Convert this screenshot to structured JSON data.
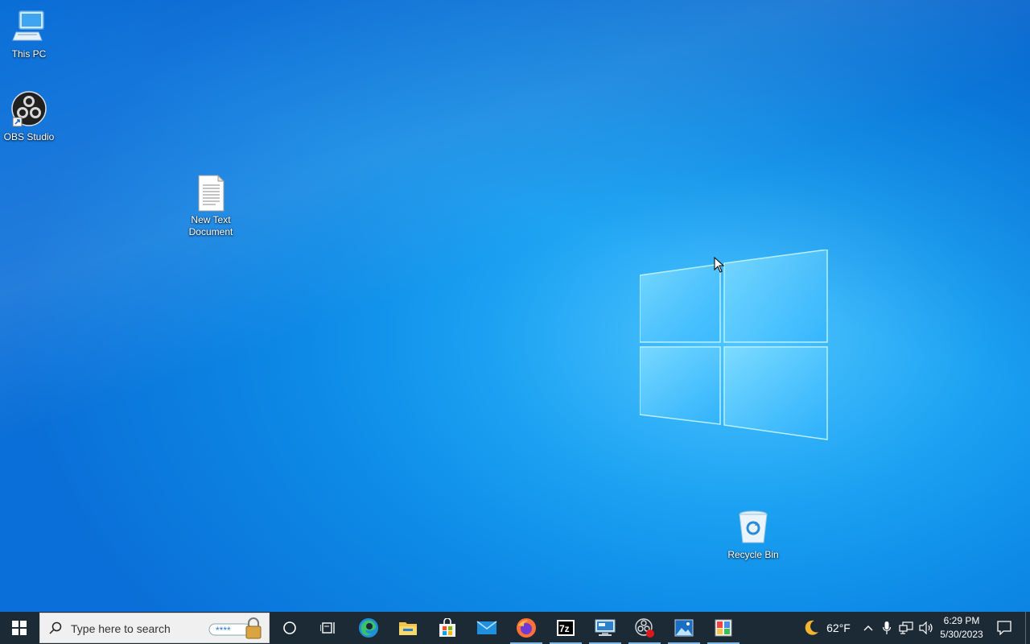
{
  "desktop": {
    "icons": {
      "this_pc": {
        "label": "This PC"
      },
      "obs": {
        "label": "OBS Studio"
      },
      "text_doc": {
        "label": "New Text Document"
      },
      "recycle": {
        "label": "Recycle Bin"
      }
    }
  },
  "taskbar": {
    "search_placeholder": "Type here to search",
    "weather_temp": "62°F",
    "clock_time": "6:29 PM",
    "clock_date": "5/30/2023",
    "apps": [
      "start-icon",
      "cortana-icon",
      "task-view-icon",
      "edge-icon",
      "file-explorer-icon",
      "store-icon",
      "mail-icon",
      "firefox-icon",
      "7zip-icon",
      "remote-desktop-icon",
      "obs-taskbar-icon",
      "photos-icon",
      "control-panel-icon"
    ]
  },
  "colors": {
    "taskbar": "#1c2a36",
    "wallpaper_blue": "#1ba1f2",
    "logo_glass": "#5fd0ff"
  }
}
